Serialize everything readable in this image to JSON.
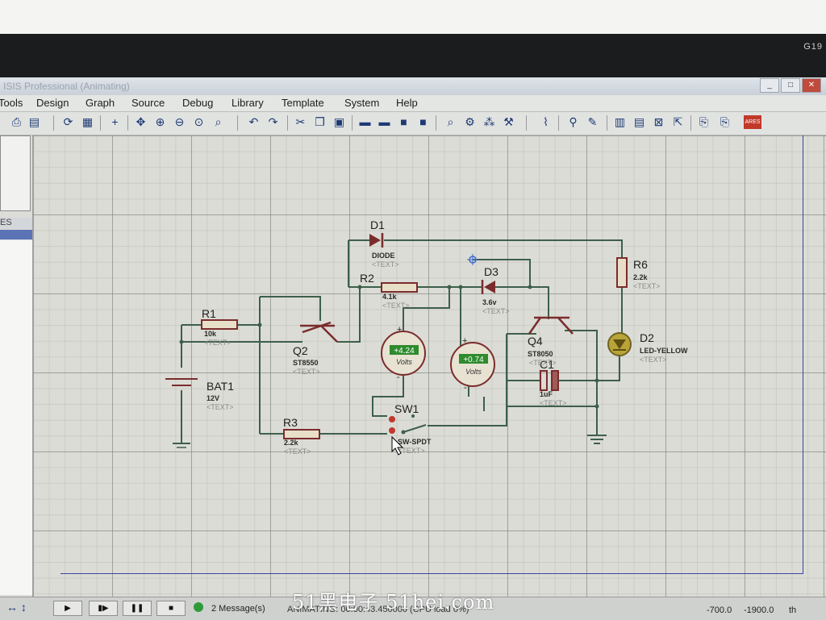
{
  "window": {
    "title": "ISIS Professional (Animating)",
    "controls": [
      "_",
      "□",
      "✕"
    ],
    "bezel_label": "G19"
  },
  "menu": {
    "items": [
      "Tools",
      "Design",
      "Graph",
      "Source",
      "Debug",
      "Library",
      "Template",
      "System",
      "Help"
    ]
  },
  "toolbar": {
    "icons": [
      "print-icon",
      "page-setup-icon",
      "refresh-icon",
      "grid-icon",
      "origin-icon",
      "pan-icon",
      "zoom-in-icon",
      "zoom-out-icon",
      "zoom-all-icon",
      "zoom-area-icon",
      "undo-icon",
      "redo-icon",
      "cut-icon",
      "copy-icon",
      "paste-icon",
      "block-copy-icon",
      "block-move-icon",
      "block-rotate-icon",
      "block-delete-icon",
      "pick-device-icon",
      "make-device-icon",
      "packaging-icon",
      "decompose-icon",
      "wire-autorouter-icon",
      "search-icon",
      "property-assign-icon",
      "netlist-icon",
      "bill-of-materials-icon",
      "electrical-rule-check-icon",
      "export-icon",
      "ares-icon"
    ],
    "ares_label": "ARES"
  },
  "left_panel": {
    "devices_label": "ES"
  },
  "schematic": {
    "components": {
      "D1": {
        "ref": "D1",
        "value": "DIODE",
        "text": "<TEXT>"
      },
      "R2": {
        "ref": "R2",
        "value": "4.1k",
        "text": "<TEXT>"
      },
      "R1": {
        "ref": "R1",
        "value": "10k",
        "text": "<TEXT>"
      },
      "Q2": {
        "ref": "Q2",
        "value": "ST8550",
        "text": "<TEXT>"
      },
      "BAT1": {
        "ref": "BAT1",
        "value": "12V",
        "text": "<TEXT>"
      },
      "R3": {
        "ref": "R3",
        "value": "2.2k",
        "text": "<TEXT>"
      },
      "D3": {
        "ref": "D3",
        "value": "3.6v",
        "text": "<TEXT>"
      },
      "Q4": {
        "ref": "Q4",
        "value": "ST8050",
        "text": "<TEXT>"
      },
      "C1": {
        "ref": "C1",
        "value": "1uF",
        "text": "<TEXT>"
      },
      "R6": {
        "ref": "R6",
        "value": "2.2k",
        "text": "<TEXT>"
      },
      "D2": {
        "ref": "D2",
        "value": "LED-YELLOW",
        "text": "<TEXT>"
      },
      "SW1": {
        "ref": "SW1",
        "value": "SW-SPDT",
        "text": "<TEXT>"
      }
    },
    "voltmeters": [
      {
        "reading": "+4.24",
        "unit": "Volts",
        "plus": "+",
        "minus": "-"
      },
      {
        "reading": "+0.74",
        "unit": "Volts",
        "plus": "+",
        "minus": "-"
      }
    ]
  },
  "status": {
    "messages": "2 Message(s)",
    "animating": "ANIMATING: 00:00:43.450000 (CPU load 0%)",
    "coord_x": "-700.0",
    "coord_y": "-1900.0",
    "units": "th"
  },
  "watermark": "51黑电子 51hei.com",
  "colors": {
    "wire": "#3d5f4a",
    "component": "#7a2c2c",
    "voltmeter_display": "#2e8b2e",
    "sheet_border": "#3a44a0"
  }
}
